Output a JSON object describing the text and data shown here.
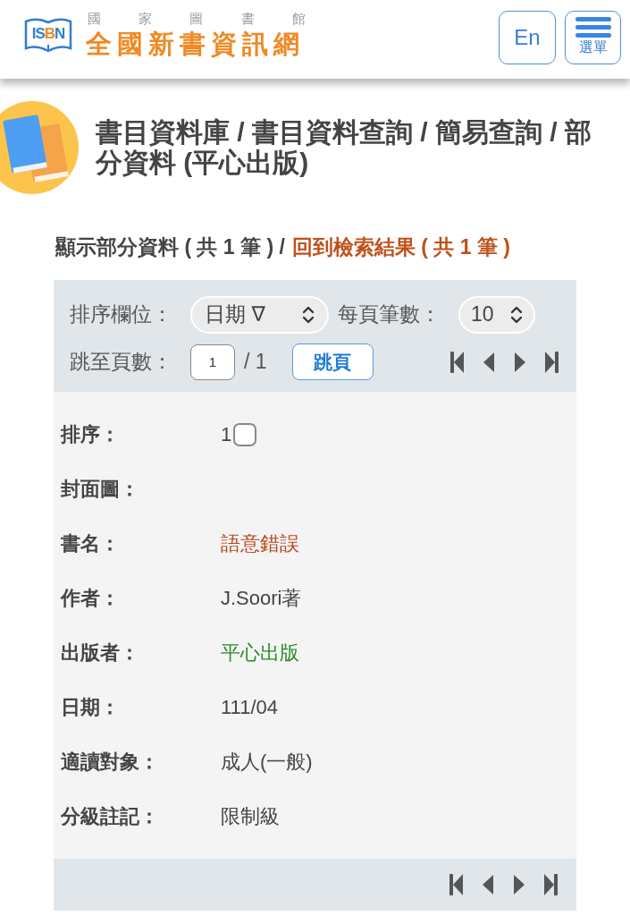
{
  "header": {
    "logo_text": "ISBN",
    "agency": "國 家 圖 書 館",
    "site_name": "全國新書資訊網",
    "language_button": "En",
    "menu_button": "選單"
  },
  "breadcrumb": "書目資料庫 / 書目資料查詢 / 簡易查詢 / 部分資料 (平心出版)",
  "summary": {
    "text": "顯示部分資料 ( 共 1 筆 ) /",
    "link": "回到檢索結果 ( 共 1 筆 )"
  },
  "toolbar": {
    "sort_label": "排序欄位：",
    "sort_value": "日期 ∇",
    "per_page_label": "每頁筆數：",
    "per_page_value": "10",
    "goto_label": "跳至頁數：",
    "page_value": "1",
    "page_total": "/ 1",
    "goto_button": "跳頁"
  },
  "record": {
    "fields": [
      {
        "kind": "check",
        "label": "排序：",
        "value": "1",
        "checked": false
      },
      {
        "kind": "cover",
        "label": "封面圖："
      },
      {
        "kind": "link",
        "label": "書名：",
        "value": "語意錯誤"
      },
      {
        "kind": "text",
        "label": "作者：",
        "value": "J.Soori著"
      },
      {
        "kind": "publisher",
        "label": "出版者：",
        "value": "平心出版"
      },
      {
        "kind": "text",
        "label": "日期：",
        "value": "111/04"
      },
      {
        "kind": "text",
        "label": "適讀對象：",
        "value": "成人(一般)"
      },
      {
        "kind": "text",
        "label": "分級註記：",
        "value": "限制級"
      }
    ]
  }
}
